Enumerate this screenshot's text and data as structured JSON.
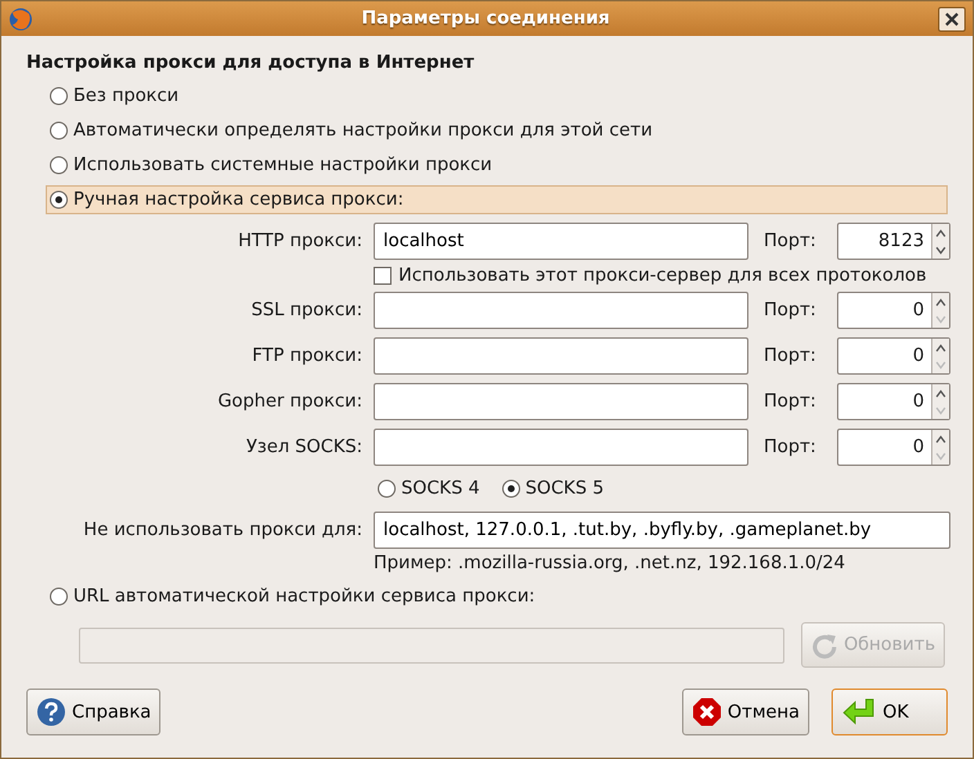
{
  "window": {
    "title": "Параметры соединения"
  },
  "heading": "Настройка прокси для доступа в Интернет",
  "modes": [
    {
      "label": "Без прокси",
      "selected": false
    },
    {
      "label": "Автоматически определять настройки прокси для этой сети",
      "selected": false
    },
    {
      "label": "Использовать системные настройки прокси",
      "selected": false
    },
    {
      "label": "Ручная настройка сервиса прокси:",
      "selected": true
    },
    {
      "label": "URL автоматической настройки сервиса прокси:",
      "selected": false
    }
  ],
  "proxies": [
    {
      "label": "HTTP прокси:",
      "value": "localhost",
      "port_label": "Порт:",
      "port": "8123"
    },
    {
      "label": "SSL прокси:",
      "port_label": "Порт:",
      "port": "0"
    },
    {
      "label": "FTP прокси:",
      "port_label": "Порт:",
      "port": "0"
    },
    {
      "label": "Gopher прокси:",
      "port_label": "Порт:",
      "port": "0"
    },
    {
      "label": "Узел SOCKS:",
      "port_label": "Порт:",
      "port": "0"
    }
  ],
  "use_all": {
    "label": "Использовать этот прокси-сервер для всех протоколов",
    "checked": false
  },
  "socks_versions": [
    {
      "label": "SOCKS 4",
      "selected": false
    },
    {
      "label": "SOCKS 5",
      "selected": true
    }
  ],
  "no_proxy": {
    "label": "Не использовать прокси для:",
    "value": "localhost, 127.0.0.1, .tut.by, .byfly.by, .gameplanet.by"
  },
  "example": "Пример: .mozilla-russia.org, .net.nz, 192.168.1.0/24",
  "auto_url": {
    "disabled": true,
    "button": "Обновить"
  },
  "buttons": [
    {
      "label": "Справка",
      "kind": "help",
      "default": false
    },
    {
      "label": "Отмена",
      "kind": "cancel",
      "default": false
    },
    {
      "label": "OK",
      "kind": "ok",
      "default": true
    }
  ]
}
